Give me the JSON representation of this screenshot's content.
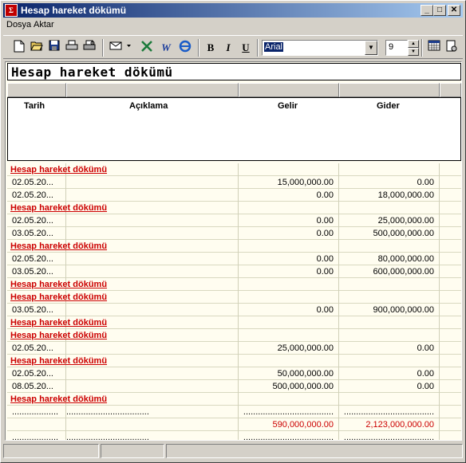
{
  "window": {
    "title": "Hesap hareket dökümü",
    "icon_text": "Σ",
    "minimize": "_",
    "maximize": "□",
    "close": "✕"
  },
  "menu": [
    {
      "label": "Dosya"
    },
    {
      "label": "Aktar"
    }
  ],
  "toolbar": {
    "icons": [
      "new-document-icon",
      "open-folder-icon",
      "save-icon",
      "print-icon",
      "print-preview-icon",
      "export-dropdown-icon",
      "excel-icon",
      "word-icon",
      "internet-explorer-icon",
      "bold-icon",
      "italic-icon",
      "underline-icon",
      "calendar-icon",
      "settings-icon"
    ],
    "bold": "B",
    "italic": "I",
    "underline": "U",
    "font": "Arial",
    "font_size": "9"
  },
  "report": {
    "title": "Hesap hareket dökümü",
    "columns": [
      "Tarih",
      "Açıklama",
      "Gelir",
      "Gider"
    ],
    "rows": [
      {
        "type": "group",
        "label": "Hesap hareket dökümü"
      },
      {
        "type": "data",
        "date": "02.05.20...",
        "desc": "",
        "gelir": "15,000,000.00",
        "gider": "0.00"
      },
      {
        "type": "data",
        "date": "02.05.20...",
        "desc": "",
        "gelir": "0.00",
        "gider": "18,000,000.00"
      },
      {
        "type": "group",
        "label": "Hesap hareket dökümü"
      },
      {
        "type": "data",
        "date": "02.05.20...",
        "desc": "",
        "gelir": "0.00",
        "gider": "25,000,000.00"
      },
      {
        "type": "data",
        "date": "03.05.20...",
        "desc": "",
        "gelir": "0.00",
        "gider": "500,000,000.00"
      },
      {
        "type": "group",
        "label": "Hesap hareket dökümü"
      },
      {
        "type": "data",
        "date": "02.05.20...",
        "desc": "",
        "gelir": "0.00",
        "gider": "80,000,000.00"
      },
      {
        "type": "data",
        "date": "03.05.20...",
        "desc": "",
        "gelir": "0.00",
        "gider": "600,000,000.00"
      },
      {
        "type": "group",
        "label": "Hesap hareket dökümü"
      },
      {
        "type": "group",
        "label": "Hesap hareket dökümü"
      },
      {
        "type": "data",
        "date": "03.05.20...",
        "desc": "",
        "gelir": "0.00",
        "gider": "900,000,000.00"
      },
      {
        "type": "group",
        "label": "Hesap hareket dökümü"
      },
      {
        "type": "group",
        "label": "Hesap hareket dökümü"
      },
      {
        "type": "data",
        "date": "02.05.20...",
        "desc": "",
        "gelir": "25,000,000.00",
        "gider": "0.00"
      },
      {
        "type": "group",
        "label": "Hesap hareket dökümü"
      },
      {
        "type": "data",
        "date": "02.05.20...",
        "desc": "",
        "gelir": "50,000,000.00",
        "gider": "0.00"
      },
      {
        "type": "data",
        "date": "08.05.20...",
        "desc": "",
        "gelir": "500,000,000.00",
        "gider": "0.00"
      },
      {
        "type": "group",
        "label": "Hesap hareket dökümü"
      },
      {
        "type": "dots",
        "date": "...................",
        "desc": "..................................",
        "gelir": ".....................................",
        "gider": "....................................."
      },
      {
        "type": "total",
        "date": "",
        "desc": "",
        "gelir": "590,000,000.00",
        "gider": "2,123,000,000.00"
      },
      {
        "type": "dots",
        "date": "...................",
        "desc": "..................................",
        "gelir": ".....................................",
        "gider": "....................................."
      }
    ]
  },
  "colors": {
    "title_gradient_start": "#0a246a",
    "group_label": "#cc0000",
    "total": "#cc0000",
    "report_bg": "#fffdf0"
  }
}
